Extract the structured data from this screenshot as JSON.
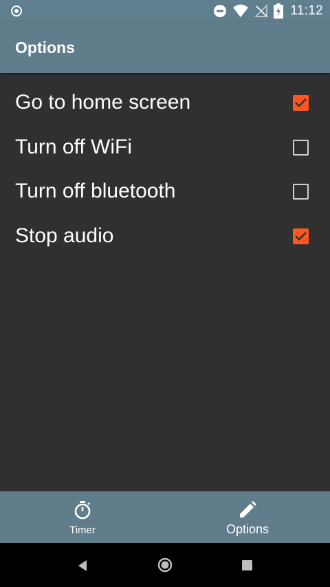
{
  "status_bar": {
    "left_icon": "location-target-icon",
    "icons": [
      "do-not-disturb-icon",
      "wifi-icon",
      "signal-off-icon",
      "battery-charging-icon"
    ],
    "time": "11:12"
  },
  "app_bar": {
    "title": "Options"
  },
  "options": [
    {
      "label": "Go to home screen",
      "checked": true
    },
    {
      "label": "Turn off WiFi",
      "checked": false
    },
    {
      "label": "Turn off bluetooth",
      "checked": false
    },
    {
      "label": "Stop audio",
      "checked": true
    }
  ],
  "bottom_nav": {
    "items": [
      {
        "label": "Timer",
        "icon": "stopwatch-icon",
        "active": false
      },
      {
        "label": "Options",
        "icon": "pencil-icon",
        "active": true
      }
    ]
  },
  "system_nav": {
    "buttons": [
      "back-icon",
      "home-icon",
      "recents-icon"
    ]
  },
  "colors": {
    "accent": "#ff5722",
    "primary": "#607d8b",
    "background": "#303030"
  }
}
